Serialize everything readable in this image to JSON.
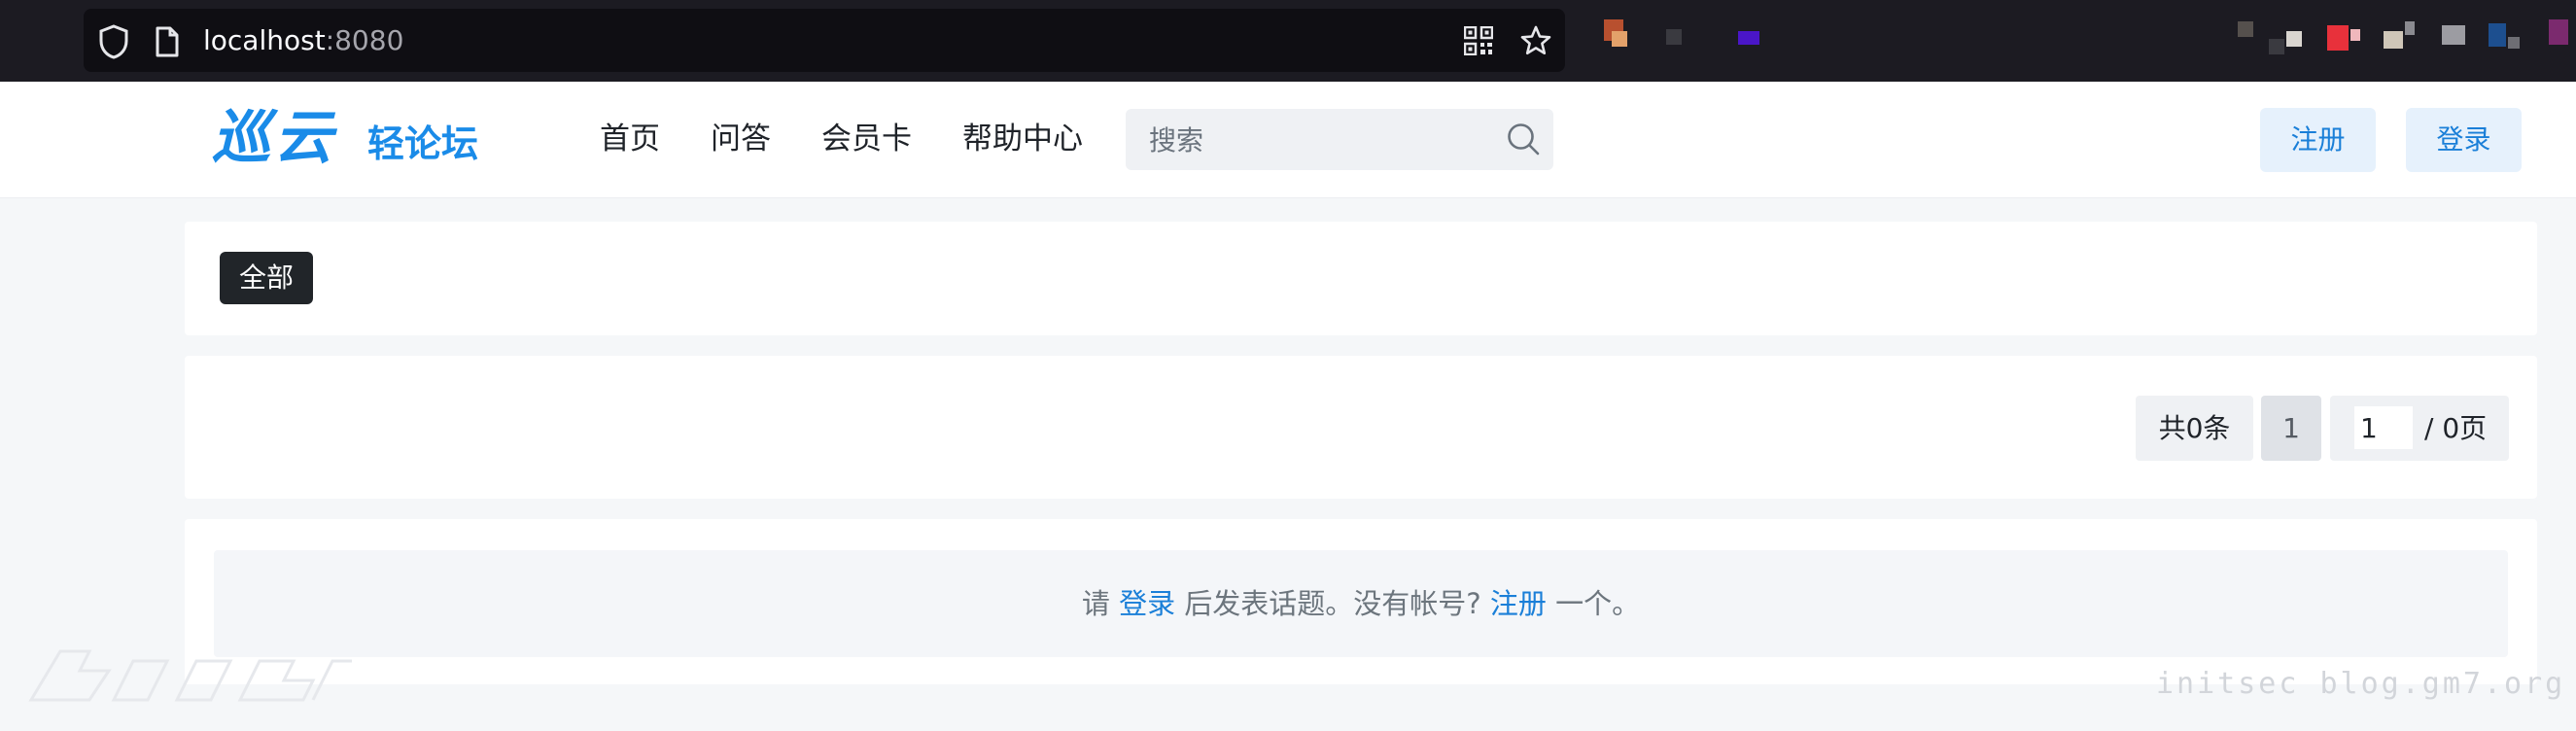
{
  "browser": {
    "url_host": "localhost",
    "url_port": ":8080"
  },
  "header": {
    "logo_main": "巡云",
    "logo_sub": "轻论坛",
    "nav": [
      "首页",
      "问答",
      "会员卡",
      "帮助中心"
    ],
    "search_placeholder": "搜索",
    "register_label": "注册",
    "login_label": "登录",
    "accent_color": "#1a8be8"
  },
  "filter": {
    "tag_all": "全部"
  },
  "pagination": {
    "total": "共0条",
    "current": "1",
    "jump_value": "1",
    "pages": "/ 0页"
  },
  "notice": {
    "prefix": "请 ",
    "login_link": "登录",
    "middle": " 后发表话题。没有帐号? ",
    "register_link": "注册",
    "suffix": " 一个。"
  },
  "watermark": {
    "right_text": "initsec blog.gm7.org"
  }
}
